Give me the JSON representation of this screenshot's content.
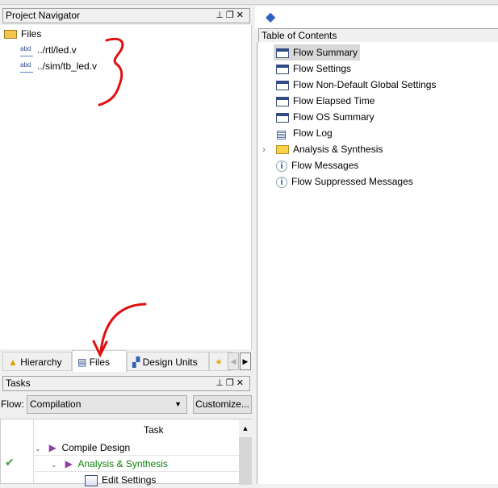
{
  "project_navigator": {
    "title": "Project Navigator",
    "root": "Files",
    "files": [
      "../rtl/led.v",
      "../sim/tb_led.v"
    ]
  },
  "nav_tabs": [
    {
      "label": "Hierarchy"
    },
    {
      "label": "Files"
    },
    {
      "label": "Design Units"
    }
  ],
  "tasks": {
    "title": "Tasks",
    "flow_label": "Flow:",
    "flow_value": "Compilation",
    "customize_label": "Customize...",
    "column_task": "Task",
    "rows": [
      {
        "label": "Compile Design",
        "status": ""
      },
      {
        "label": "Analysis & Synthesis",
        "status": "success"
      },
      {
        "label": "Edit Settings",
        "status": ""
      }
    ]
  },
  "toc": {
    "title": "Table of Contents",
    "items": [
      {
        "label": "Flow Summary",
        "icon": "table-icon",
        "selected": true
      },
      {
        "label": "Flow Settings",
        "icon": "table-icon"
      },
      {
        "label": "Flow Non-Default Global Settings",
        "icon": "table-icon"
      },
      {
        "label": "Flow Elapsed Time",
        "icon": "table-icon"
      },
      {
        "label": "Flow OS Summary",
        "icon": "table-icon"
      },
      {
        "label": "Flow Log",
        "icon": "document-icon"
      },
      {
        "label": "Analysis & Synthesis",
        "icon": "folder-icon",
        "expandable": true
      },
      {
        "label": "Flow Messages",
        "icon": "info-icon"
      },
      {
        "label": "Flow Suppressed Messages",
        "icon": "info-icon"
      }
    ]
  },
  "colors": {
    "annotation": "#e01010",
    "success_text": "#108010",
    "selected_bg": "#d9d9d9"
  }
}
